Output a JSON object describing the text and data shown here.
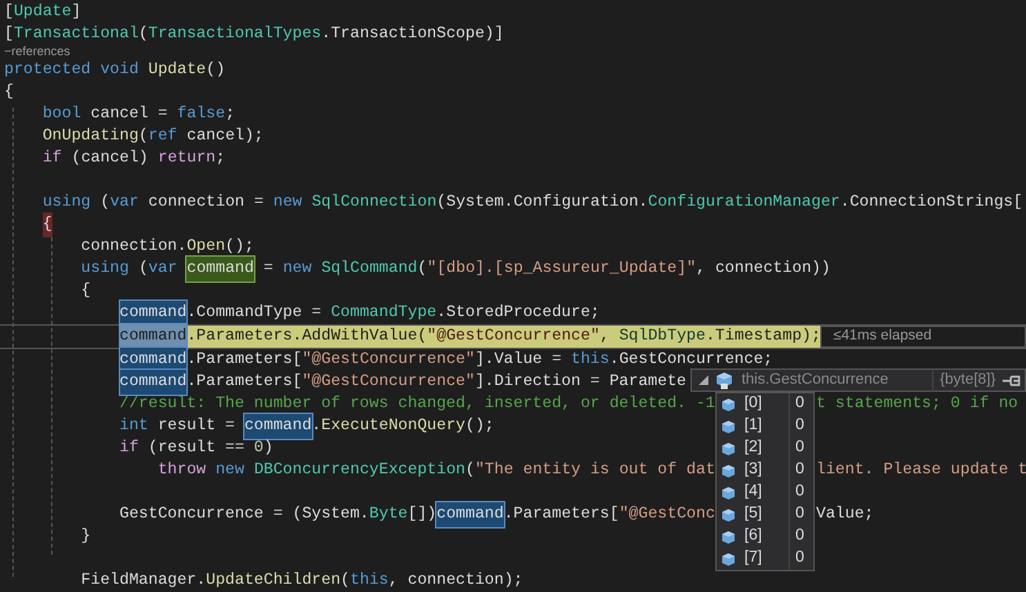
{
  "editor": {
    "lines": [
      {
        "kind": "code",
        "tokens": [
          {
            "text": "[",
            "kind": "plain"
          },
          {
            "text": "Update",
            "kind": "type"
          },
          {
            "text": "]",
            "kind": "plain"
          }
        ]
      },
      {
        "kind": "code",
        "tokens": [
          {
            "text": "[",
            "kind": "plain"
          },
          {
            "text": "Transactional",
            "kind": "type"
          },
          {
            "text": "(",
            "kind": "plain"
          },
          {
            "text": "TransactionalTypes",
            "kind": "type"
          },
          {
            "text": ".TransactionScope)]",
            "kind": "plain"
          }
        ]
      },
      {
        "kind": "codelens",
        "text": "−references"
      },
      {
        "kind": "code",
        "tokens": [
          {
            "text": "protected void",
            "kind": "keyword"
          },
          {
            "text": " Update",
            "kind": "method"
          },
          {
            "text": "()",
            "kind": "plain"
          }
        ]
      },
      {
        "kind": "code",
        "tokens": [
          {
            "text": "{",
            "kind": "plain"
          }
        ]
      },
      {
        "kind": "code",
        "tokens": [
          {
            "text": "    bool",
            "kind": "keyword"
          },
          {
            "text": " cancel = ",
            "kind": "plain"
          },
          {
            "text": "false",
            "kind": "keyword"
          },
          {
            "text": ";",
            "kind": "plain"
          }
        ]
      },
      {
        "kind": "code",
        "tokens": [
          {
            "text": "    OnUpdating",
            "kind": "method"
          },
          {
            "text": "(",
            "kind": "plain"
          },
          {
            "text": "ref",
            "kind": "keyword"
          },
          {
            "text": " cancel);",
            "kind": "plain"
          }
        ]
      },
      {
        "kind": "code",
        "tokens": [
          {
            "text": "    if",
            "kind": "control"
          },
          {
            "text": " (cancel) ",
            "kind": "plain"
          },
          {
            "text": "return",
            "kind": "control"
          },
          {
            "text": ";",
            "kind": "plain"
          }
        ]
      },
      {
        "kind": "blank"
      },
      {
        "kind": "code",
        "tokens": [
          {
            "text": "    using",
            "kind": "keyword"
          },
          {
            "text": " (",
            "kind": "plain"
          },
          {
            "text": "var",
            "kind": "keyword"
          },
          {
            "text": " connection = ",
            "kind": "plain"
          },
          {
            "text": "new",
            "kind": "keyword"
          },
          {
            "text": " SqlConnection",
            "kind": "type"
          },
          {
            "text": "(System.Configuration.",
            "kind": "plain"
          },
          {
            "text": "ConfigurationManager",
            "kind": "type"
          },
          {
            "text": ".ConnectionStrings[",
            "kind": "plain"
          }
        ]
      },
      {
        "kind": "code",
        "tokens": [
          {
            "text": "    {",
            "kind": "brace_match"
          }
        ]
      },
      {
        "kind": "code",
        "tokens": [
          {
            "text": "        connection.",
            "kind": "plain"
          },
          {
            "text": "Open",
            "kind": "method"
          },
          {
            "text": "();",
            "kind": "plain"
          }
        ]
      },
      {
        "kind": "code",
        "tokens": [
          {
            "text": "        using",
            "kind": "keyword"
          },
          {
            "text": " (",
            "kind": "plain"
          },
          {
            "text": "var",
            "kind": "keyword"
          },
          {
            "text": " command",
            "kind": "definition"
          },
          {
            "text": " = ",
            "kind": "plain"
          },
          {
            "text": "new",
            "kind": "keyword"
          },
          {
            "text": " SqlCommand",
            "kind": "type"
          },
          {
            "text": "(",
            "kind": "plain"
          },
          {
            "text": "\"[dbo].[sp_Assureur_Update]\"",
            "kind": "string"
          },
          {
            "text": ", connection))",
            "kind": "plain"
          }
        ]
      },
      {
        "kind": "code",
        "tokens": [
          {
            "text": "        {",
            "kind": "plain"
          }
        ]
      },
      {
        "kind": "code",
        "tokens": [
          {
            "text": "            command",
            "kind": "reference"
          },
          {
            "text": ".CommandType = ",
            "kind": "plain"
          },
          {
            "text": "CommandType",
            "kind": "type"
          },
          {
            "text": ".StoredProcedure;",
            "kind": "plain"
          }
        ]
      },
      {
        "kind": "code",
        "current": true,
        "perf_tip": "≤41ms elapsed",
        "tokens": [
          {
            "text": "            command",
            "kind": "reference"
          },
          {
            "text": ".Parameters.",
            "kind": "plain"
          },
          {
            "text": "AddWithValue",
            "kind": "method"
          },
          {
            "text": "(",
            "kind": "plain"
          },
          {
            "text": "\"@GestConcurrence\"",
            "kind": "string"
          },
          {
            "text": ", ",
            "kind": "plain"
          },
          {
            "text": "SqlDbType",
            "kind": "type"
          },
          {
            "text": ".Timestamp);",
            "kind": "plain"
          }
        ]
      },
      {
        "kind": "code",
        "tokens": [
          {
            "text": "            command",
            "kind": "reference"
          },
          {
            "text": ".Parameters[",
            "kind": "plain"
          },
          {
            "text": "\"@GestConcurrence\"",
            "kind": "string"
          },
          {
            "text": "].Value = ",
            "kind": "plain"
          },
          {
            "text": "this",
            "kind": "keyword"
          },
          {
            "text": ".GestConcurrence;",
            "kind": "plain"
          }
        ]
      },
      {
        "kind": "code",
        "tokens": [
          {
            "text": "            command",
            "kind": "reference"
          },
          {
            "text": ".Parameters[",
            "kind": "plain"
          },
          {
            "text": "\"@GestConcurrence\"",
            "kind": "string"
          },
          {
            "text": "].Direction = Paramete",
            "kind": "plain"
          }
        ]
      },
      {
        "kind": "code",
        "tokens": [
          {
            "text": "            //result: The number of rows changed, inserted, or deleted. -1",
            "kind": "comment"
          }
        ],
        "after": [
          {
            "text": "t statements; 0 if no",
            "kind": "comment"
          }
        ]
      },
      {
        "kind": "code",
        "tokens": [
          {
            "text": "            int",
            "kind": "keyword"
          },
          {
            "text": " result = ",
            "kind": "plain"
          },
          {
            "text": "command",
            "kind": "reference"
          },
          {
            "text": ".",
            "kind": "plain"
          },
          {
            "text": "ExecuteNonQuery",
            "kind": "method"
          },
          {
            "text": "();",
            "kind": "plain"
          }
        ]
      },
      {
        "kind": "code",
        "tokens": [
          {
            "text": "            if",
            "kind": "control"
          },
          {
            "text": " (result == ",
            "kind": "plain"
          },
          {
            "text": "0",
            "kind": "number"
          },
          {
            "text": ")",
            "kind": "plain"
          }
        ]
      },
      {
        "kind": "code",
        "tokens": [
          {
            "text": "                throw",
            "kind": "control"
          },
          {
            "text": " new",
            "kind": "keyword"
          },
          {
            "text": " DBConcurrencyException",
            "kind": "type"
          },
          {
            "text": "(",
            "kind": "plain"
          },
          {
            "text": "\"The entity is out of dat",
            "kind": "string"
          }
        ],
        "after": [
          {
            "text": "lient. Please update t",
            "kind": "string"
          }
        ]
      },
      {
        "kind": "blank"
      },
      {
        "kind": "code",
        "tokens": [
          {
            "text": "            GestConcurrence = (System.",
            "kind": "plain"
          },
          {
            "text": "Byte",
            "kind": "type"
          },
          {
            "text": "[])",
            "kind": "plain"
          },
          {
            "text": "command",
            "kind": "reference"
          },
          {
            "text": ".Parameters[",
            "kind": "plain"
          },
          {
            "text": "\"@GestConc",
            "kind": "string"
          }
        ],
        "after": [
          {
            "text": "Value;",
            "kind": "plain"
          }
        ]
      },
      {
        "kind": "code",
        "tokens": [
          {
            "text": "        }",
            "kind": "plain"
          }
        ]
      },
      {
        "kind": "blank"
      },
      {
        "kind": "code",
        "tokens": [
          {
            "text": "        FieldManager.",
            "kind": "plain"
          },
          {
            "text": "UpdateChildren",
            "kind": "method"
          },
          {
            "text": "(",
            "kind": "plain"
          },
          {
            "text": "this",
            "kind": "keyword"
          },
          {
            "text": ", connection);",
            "kind": "plain"
          }
        ]
      }
    ]
  },
  "datatip": {
    "expanded": true,
    "expression": "this.GestConcurrence",
    "value": "{byte[8]}",
    "items": [
      {
        "name": "[0]",
        "value": "0"
      },
      {
        "name": "[1]",
        "value": "0"
      },
      {
        "name": "[2]",
        "value": "0"
      },
      {
        "name": "[3]",
        "value": "0"
      },
      {
        "name": "[4]",
        "value": "0"
      },
      {
        "name": "[5]",
        "value": "0"
      },
      {
        "name": "[6]",
        "value": "0"
      },
      {
        "name": "[7]",
        "value": "0"
      }
    ]
  }
}
